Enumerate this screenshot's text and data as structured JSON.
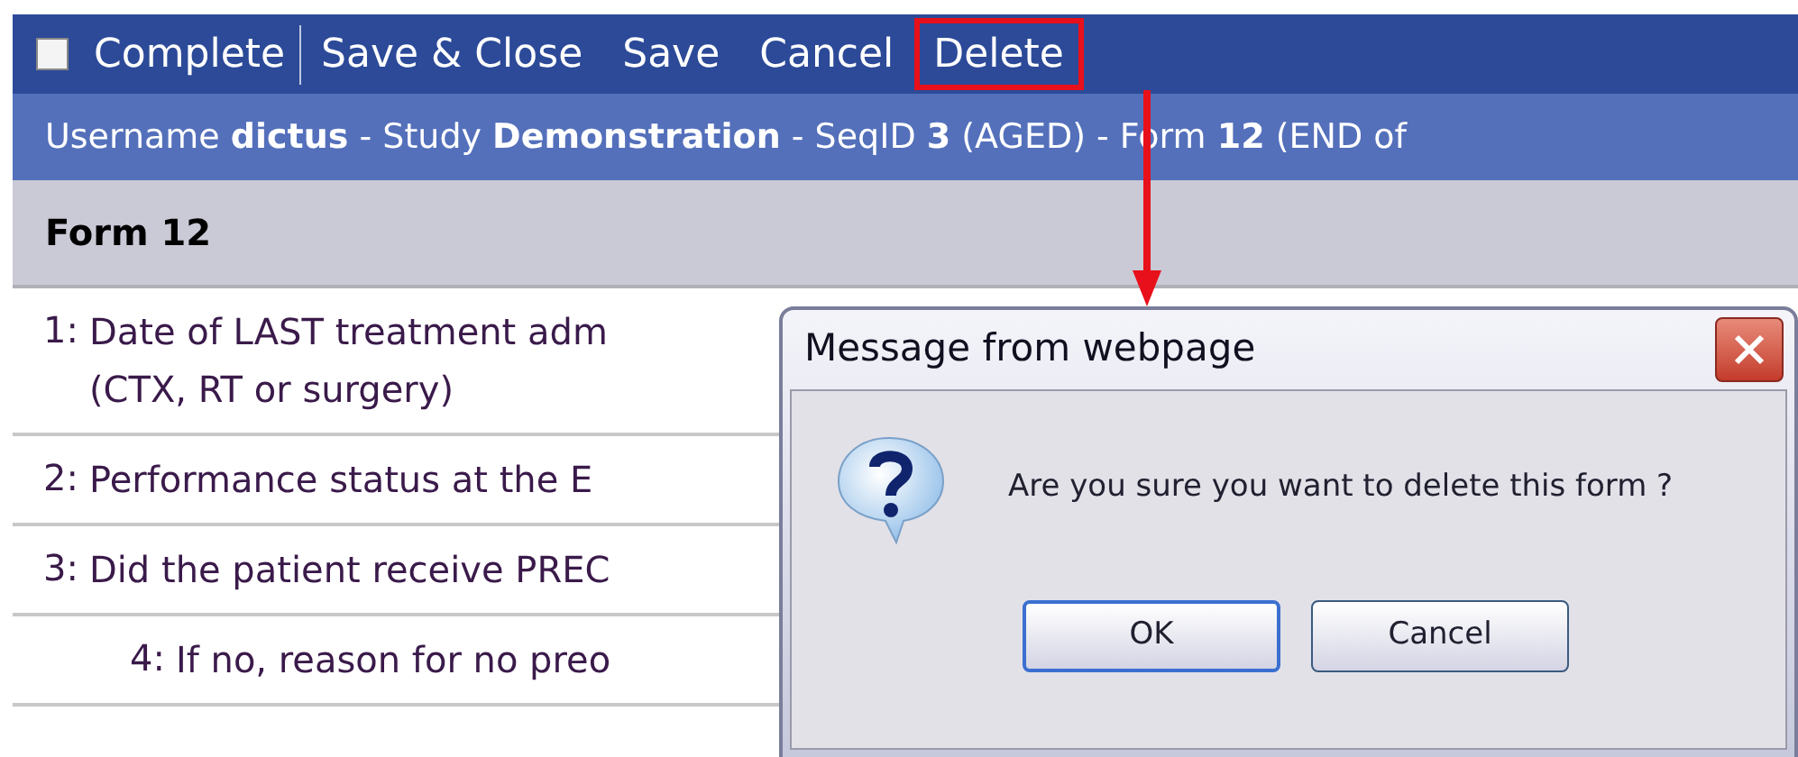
{
  "toolbar": {
    "complete": {
      "label": "Complete",
      "checked": false
    },
    "buttons": [
      {
        "label": "Save & Close",
        "highlighted": false
      },
      {
        "label": "Save",
        "highlighted": false
      },
      {
        "label": "Cancel",
        "highlighted": false
      },
      {
        "label": "Delete",
        "highlighted": true
      }
    ]
  },
  "info_bar": "Username **dictus** - Study **Demonstration** - SeqID **3** (AGED) - Form **12** (END of",
  "form_header": "Form 12",
  "questions": [
    {
      "number": "1:",
      "lines": [
        "Date of LAST treatment adm",
        "(CTX, RT or surgery)"
      ]
    },
    {
      "number": "2:",
      "lines": [
        "Performance status at the E"
      ]
    },
    {
      "number": "3:",
      "lines": [
        "Did the patient receive PREC"
      ],
      "children": [
        {
          "number": "4:",
          "lines": [
            "If no, reason for no preo"
          ]
        }
      ]
    }
  ],
  "dialog": {
    "title": "Message from webpage",
    "message": "Are you sure you want to delete this form ?",
    "buttons": [
      {
        "label": "OK",
        "default": true
      },
      {
        "label": "Cancel",
        "default": false
      }
    ]
  }
}
